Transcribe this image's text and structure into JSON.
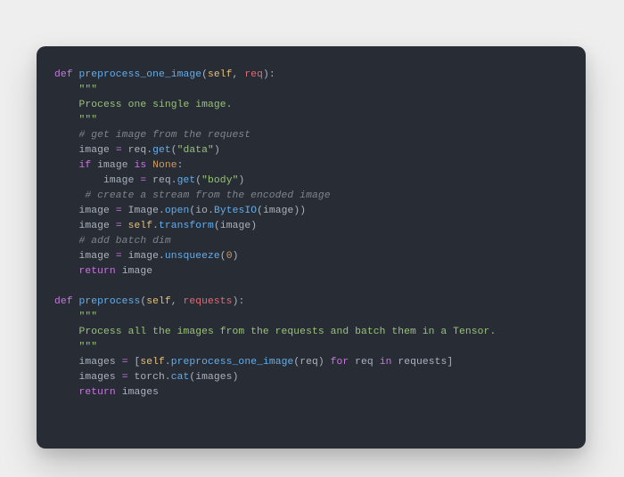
{
  "code": {
    "fn1": {
      "def": "def",
      "name": "preprocess_one_image",
      "lp": "(",
      "self": "self",
      "comma": ", ",
      "arg": "req",
      "rp": "):",
      "docq1": "\"\"\"",
      "doc": "Process one single image.",
      "docq2": "\"\"\"",
      "c1": "# get image from the request",
      "l1a": "image ",
      "l1op": "=",
      "l1b": " req",
      "l1dot": ".",
      "l1get": "get",
      "l1lp": "(",
      "l1s": "\"data\"",
      "l1rp": ")",
      "l2if": "if",
      "l2b": " image ",
      "l2is": "is",
      "l2sp": " ",
      "l2none": "None",
      "l2col": ":",
      "l3a": "image ",
      "l3op": "=",
      "l3b": " req",
      "l3dot": ".",
      "l3get": "get",
      "l3lp": "(",
      "l3s": "\"body\"",
      "l3rp": ")",
      "c2": " # create a stream from the encoded image",
      "l4a": "image ",
      "l4op": "=",
      "l4b": " Image",
      "l4dot": ".",
      "l4open": "open",
      "l4lp": "(",
      "l4io": "io",
      "l4dot2": ".",
      "l4by": "BytesIO",
      "l4lp2": "(",
      "l4im": "image",
      "l4rp": "))",
      "l5a": "image ",
      "l5op": "=",
      "l5sp": " ",
      "l5self": "self",
      "l5dot": ".",
      "l5tr": "transform",
      "l5lp": "(",
      "l5im": "image",
      "l5rp": ")",
      "c3": "# add batch dim",
      "l6a": "image ",
      "l6op": "=",
      "l6b": " image",
      "l6dot": ".",
      "l6un": "unsqueeze",
      "l6lp": "(",
      "l6n": "0",
      "l6rp": ")",
      "ret": "return",
      "retv": " image"
    },
    "fn2": {
      "def": "def",
      "name": "preprocess",
      "lp": "(",
      "self": "self",
      "comma": ", ",
      "arg": "requests",
      "rp": "):",
      "docq1": "\"\"\"",
      "doc": "Process all the images from the requests and batch them in a Tensor.",
      "docq2": "\"\"\"",
      "l1a": "images ",
      "l1op": "=",
      "l1b": " [",
      "l1self": "self",
      "l1dot": ".",
      "l1pp": "preprocess_one_image",
      "l1lp": "(",
      "l1req": "req",
      "l1rp": ") ",
      "l1for": "for",
      "l1sp": " req ",
      "l1in": "in",
      "l1sp2": " requests]",
      "l2a": "images ",
      "l2op": "=",
      "l2b": " torch",
      "l2dot": ".",
      "l2cat": "cat",
      "l2lp": "(",
      "l2im": "images",
      "l2rp": ")",
      "ret": "return",
      "retv": " images"
    }
  }
}
